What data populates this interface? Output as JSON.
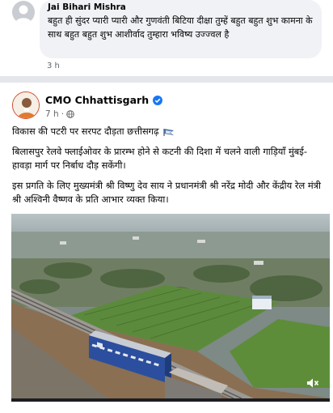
{
  "comment": {
    "author": "Jai Bihari Mishra",
    "text": "बहुत ही सुंदर प्यारी प्यारी और गुणवंती बिटिया दीक्षा तुम्हें बहुत बहुत शुभ कामना के साथ बहुत बहुत शुभ आशीर्वाद तुम्हारा भविष्य उज्ज्वल है",
    "time": "3 h"
  },
  "post": {
    "author": "CMO Chhattisgarh",
    "time": "7 h",
    "separator": "·",
    "headline": "विकास की पटरी पर सरपट दौड़ता छत्तीसगढ़",
    "paragraph1": "बिलासपुर रेलवे फ्लाईओवर के प्रारम्भ होने से कटनी की दिशा में चलने वाली गाड़ियाँ मुंबई-हावड़ा मार्ग पर निर्बाध दौड़ सकेंगी।",
    "paragraph2": "इस प्रगति के लिए मुख्यमंत्री श्री विष्णु देव साय ने प्रधानमंत्री श्री नरेंद्र मोदी और केंद्रीय रेल मंत्री श्री अश्विनी वैष्णव के प्रति आभार व्यक्त किया।"
  },
  "icons": {
    "verified": "verified-badge-icon",
    "globe": "globe-icon",
    "flag": "flag-icon",
    "mute": "speaker-muted-icon",
    "avatar": "default-avatar-icon"
  },
  "colors": {
    "link_blue": "#1877f2",
    "secondary_text": "#65676b"
  }
}
